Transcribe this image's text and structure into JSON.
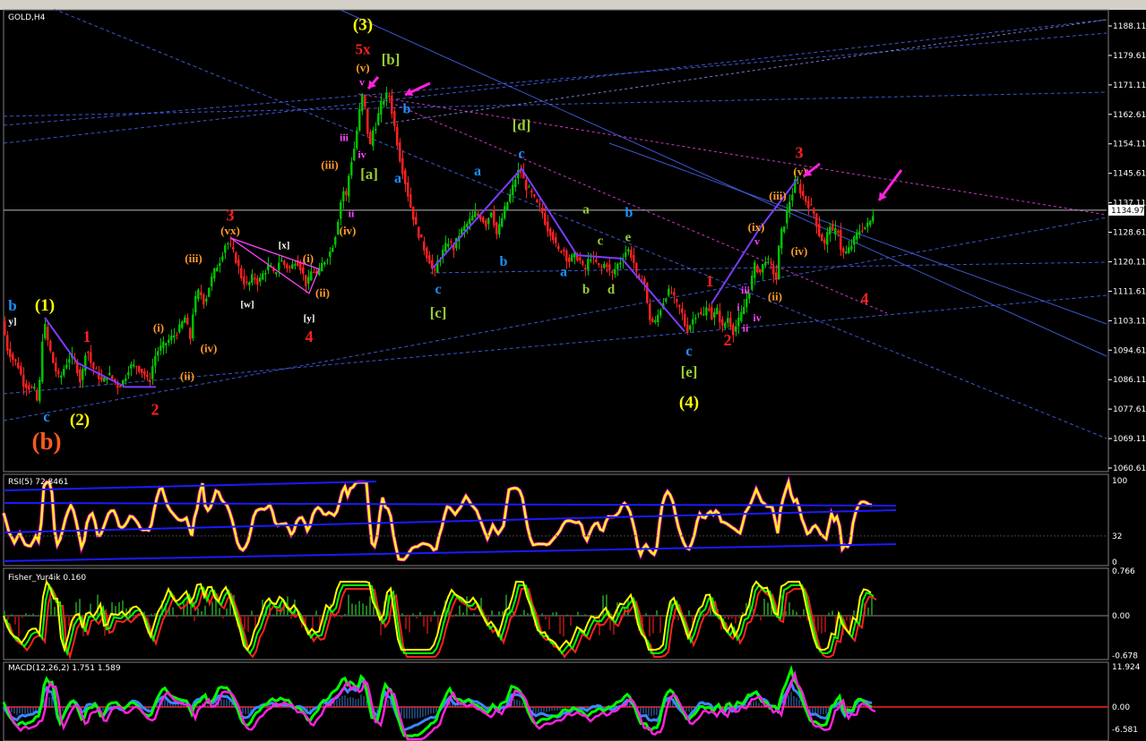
{
  "chart_data": [
    {
      "type": "candlestick",
      "title": "GOLD,H4",
      "ylim": [
        1058,
        1192
      ],
      "y_ticks": [
        "1188.11",
        "1179.61",
        "1171.11",
        "1162.61",
        "1154.11",
        "1145.61",
        "1137.11",
        "1128.61",
        "1120.11",
        "1111.61",
        "1103.11",
        "1094.61",
        "1086.11",
        "1077.61",
        "1069.11",
        "1060.61"
      ],
      "y_tick_values": [
        1188.11,
        1179.61,
        1171.11,
        1162.61,
        1154.11,
        1145.61,
        1137.11,
        1128.61,
        1120.11,
        1111.61,
        1103.11,
        1094.61,
        1086.11,
        1077.61,
        1069.11,
        1060.61
      ],
      "current_price": "1134.97",
      "current_price_value": 1134.97,
      "price_path": [
        [
          0,
          1103
        ],
        [
          6,
          1095
        ],
        [
          12,
          1092
        ],
        [
          18,
          1090
        ],
        [
          24,
          1085
        ],
        [
          30,
          1084
        ],
        [
          36,
          1083
        ],
        [
          40,
          1079
        ],
        [
          44,
          1092
        ],
        [
          46,
          1104
        ],
        [
          52,
          1096
        ],
        [
          58,
          1090
        ],
        [
          64,
          1086
        ],
        [
          70,
          1090
        ],
        [
          76,
          1093
        ],
        [
          82,
          1091
        ],
        [
          88,
          1085
        ],
        [
          94,
          1096
        ],
        [
          100,
          1090
        ],
        [
          106,
          1088
        ],
        [
          112,
          1085
        ],
        [
          118,
          1088
        ],
        [
          124,
          1086
        ],
        [
          130,
          1084
        ],
        [
          136,
          1086
        ],
        [
          142,
          1090
        ],
        [
          150,
          1090
        ],
        [
          158,
          1088
        ],
        [
          164,
          1085
        ],
        [
          168,
          1090
        ],
        [
          172,
          1094
        ],
        [
          180,
          1096
        ],
        [
          188,
          1098
        ],
        [
          196,
          1100
        ],
        [
          204,
          1104
        ],
        [
          210,
          1098
        ],
        [
          214,
          1108
        ],
        [
          220,
          1112
        ],
        [
          226,
          1108
        ],
        [
          232,
          1114
        ],
        [
          238,
          1118
        ],
        [
          244,
          1121
        ],
        [
          250,
          1126
        ],
        [
          256,
          1124
        ],
        [
          262,
          1120
        ],
        [
          268,
          1115
        ],
        [
          274,
          1113
        ],
        [
          280,
          1116
        ],
        [
          286,
          1114
        ],
        [
          292,
          1117
        ],
        [
          298,
          1119
        ],
        [
          304,
          1116
        ],
        [
          310,
          1121
        ],
        [
          316,
          1119
        ],
        [
          322,
          1118
        ],
        [
          328,
          1121
        ],
        [
          334,
          1118
        ],
        [
          340,
          1113
        ],
        [
          346,
          1118
        ],
        [
          352,
          1116
        ],
        [
          358,
          1120
        ],
        [
          362,
          1121
        ],
        [
          368,
          1124
        ],
        [
          372,
          1128
        ],
        [
          376,
          1134
        ],
        [
          380,
          1141
        ],
        [
          384,
          1139
        ],
        [
          388,
          1147
        ],
        [
          394,
          1154
        ],
        [
          398,
          1162
        ],
        [
          402,
          1168
        ],
        [
          406,
          1163
        ],
        [
          410,
          1152
        ],
        [
          414,
          1158
        ],
        [
          418,
          1160
        ],
        [
          422,
          1165
        ],
        [
          428,
          1168
        ],
        [
          432,
          1168
        ],
        [
          436,
          1162
        ],
        [
          440,
          1156
        ],
        [
          444,
          1150
        ],
        [
          450,
          1143
        ],
        [
          456,
          1136
        ],
        [
          462,
          1130
        ],
        [
          468,
          1126
        ],
        [
          474,
          1122
        ],
        [
          478,
          1120
        ],
        [
          482,
          1116
        ],
        [
          486,
          1120
        ],
        [
          492,
          1123
        ],
        [
          498,
          1126
        ],
        [
          504,
          1124
        ],
        [
          510,
          1128
        ],
        [
          516,
          1130
        ],
        [
          522,
          1132
        ],
        [
          528,
          1134
        ],
        [
          534,
          1133
        ],
        [
          540,
          1131
        ],
        [
          546,
          1135
        ],
        [
          552,
          1128
        ],
        [
          556,
          1131
        ],
        [
          562,
          1136
        ],
        [
          568,
          1140
        ],
        [
          574,
          1145
        ],
        [
          578,
          1147
        ],
        [
          584,
          1142
        ],
        [
          590,
          1140
        ],
        [
          596,
          1137
        ],
        [
          602,
          1135
        ],
        [
          608,
          1130
        ],
        [
          614,
          1128
        ],
        [
          620,
          1123
        ],
        [
          626,
          1124
        ],
        [
          632,
          1120
        ],
        [
          638,
          1122
        ],
        [
          644,
          1121
        ],
        [
          650,
          1117
        ],
        [
          656,
          1122
        ],
        [
          662,
          1120
        ],
        [
          668,
          1118
        ],
        [
          674,
          1120
        ],
        [
          680,
          1116
        ],
        [
          686,
          1119
        ],
        [
          692,
          1121
        ],
        [
          698,
          1124
        ],
        [
          704,
          1121
        ],
        [
          710,
          1114
        ],
        [
          716,
          1116
        ],
        [
          722,
          1104
        ],
        [
          728,
          1102
        ],
        [
          734,
          1106
        ],
        [
          740,
          1110
        ],
        [
          746,
          1112
        ],
        [
          752,
          1108
        ],
        [
          758,
          1106
        ],
        [
          764,
          1100
        ],
        [
          770,
          1103
        ],
        [
          776,
          1106
        ],
        [
          782,
          1104
        ],
        [
          788,
          1108
        ],
        [
          792,
          1104
        ],
        [
          798,
          1106
        ],
        [
          804,
          1101
        ],
        [
          810,
          1104
        ],
        [
          816,
          1100
        ],
        [
          822,
          1103
        ],
        [
          828,
          1107
        ],
        [
          834,
          1112
        ],
        [
          840,
          1119
        ],
        [
          846,
          1117
        ],
        [
          852,
          1121
        ],
        [
          858,
          1119
        ],
        [
          864,
          1115
        ],
        [
          868,
          1127
        ],
        [
          874,
          1132
        ],
        [
          878,
          1137
        ],
        [
          882,
          1140
        ],
        [
          886,
          1144
        ],
        [
          890,
          1141
        ],
        [
          896,
          1138
        ],
        [
          902,
          1136
        ],
        [
          906,
          1134
        ],
        [
          912,
          1128
        ],
        [
          918,
          1125
        ],
        [
          924,
          1131
        ],
        [
          928,
          1127
        ],
        [
          932,
          1131
        ],
        [
          936,
          1124
        ],
        [
          940,
          1122
        ],
        [
          946,
          1124
        ],
        [
          950,
          1126
        ],
        [
          956,
          1129
        ],
        [
          962,
          1130
        ],
        [
          968,
          1131
        ],
        [
          972,
          1134
        ]
      ],
      "wave_labels": [
        {
          "text": "(3)",
          "price": 1187,
          "bar": 401,
          "color": "#ffff00",
          "size": 19
        },
        {
          "text": "5x",
          "price": 1180,
          "bar": 401,
          "color": "#ff2020",
          "size": 17
        },
        {
          "text": "(v)",
          "price": 1175,
          "bar": 401,
          "color": "#ff9a28",
          "size": 13
        },
        {
          "text": "v",
          "price": 1171,
          "bar": 400,
          "color": "#ff44ff",
          "size": 12
        },
        {
          "text": "[b]",
          "price": 1177,
          "bar": 432,
          "color": "#9acd32",
          "size": 17
        },
        {
          "text": "b",
          "price": 1163,
          "bar": 450,
          "color": "#1e90ff",
          "size": 16
        },
        {
          "text": "iii",
          "price": 1155,
          "bar": 380,
          "color": "#ff44ff",
          "size": 12
        },
        {
          "text": "iv",
          "price": 1150,
          "bar": 400,
          "color": "#ff44ff",
          "size": 12
        },
        {
          "text": "(iii)",
          "price": 1147,
          "bar": 364,
          "color": "#ff9a28",
          "size": 13
        },
        {
          "text": "[a]",
          "price": 1144,
          "bar": 408,
          "color": "#9acd32",
          "size": 17
        },
        {
          "text": "a",
          "price": 1143,
          "bar": 440,
          "color": "#1e90ff",
          "size": 16
        },
        {
          "text": "ii",
          "price": 1133,
          "bar": 388,
          "color": "#ff44ff",
          "size": 12
        },
        {
          "text": "(iv)",
          "price": 1128,
          "bar": 384,
          "color": "#ff9a28",
          "size": 13
        },
        {
          "text": "3",
          "price": 1132,
          "bar": 253,
          "color": "#ff2020",
          "size": 18
        },
        {
          "text": "(vx)",
          "price": 1128,
          "bar": 253,
          "color": "#ff9a28",
          "size": 13
        },
        {
          "text": "[x]",
          "price": 1124,
          "bar": 313,
          "color": "#ffffff",
          "size": 11
        },
        {
          "text": "(iii)",
          "price": 1120,
          "bar": 212,
          "color": "#ff9a28",
          "size": 13
        },
        {
          "text": "(i)",
          "price": 1120,
          "bar": 340,
          "color": "#ff9a28",
          "size": 13
        },
        {
          "text": "(ii)",
          "price": 1110,
          "bar": 356,
          "color": "#ff9a28",
          "size": 13
        },
        {
          "text": "[w]",
          "price": 1107,
          "bar": 272,
          "color": "#ffffff",
          "size": 11
        },
        {
          "text": "[y]",
          "price": 1103,
          "bar": 341,
          "color": "#ffffff",
          "size": 11
        },
        {
          "text": "4",
          "price": 1097,
          "bar": 341,
          "color": "#ff2020",
          "size": 18
        },
        {
          "text": "b",
          "price": 1106,
          "bar": 10,
          "color": "#1e90ff",
          "size": 17
        },
        {
          "text": "(1)",
          "price": 1106,
          "bar": 46,
          "color": "#ffff00",
          "size": 19
        },
        {
          "text": "y]",
          "price": 1102,
          "bar": 10,
          "color": "#ffffff",
          "size": 11
        },
        {
          "text": "1",
          "price": 1097,
          "bar": 93,
          "color": "#ff2020",
          "size": 18
        },
        {
          "text": "(i)",
          "price": 1100,
          "bar": 173,
          "color": "#ff9a28",
          "size": 13
        },
        {
          "text": "(iv)",
          "price": 1094,
          "bar": 229,
          "color": "#ff9a28",
          "size": 13
        },
        {
          "text": "(ii)",
          "price": 1086,
          "bar": 205,
          "color": "#ff9a28",
          "size": 13
        },
        {
          "text": "2",
          "price": 1076,
          "bar": 169,
          "color": "#ff2020",
          "size": 18
        },
        {
          "text": "c",
          "price": 1074,
          "bar": 48,
          "color": "#1e90ff",
          "size": 17
        },
        {
          "text": "(2)",
          "price": 1073,
          "bar": 85,
          "color": "#ffff00",
          "size": 19
        },
        {
          "text": "(b)",
          "price": 1066,
          "bar": 48,
          "color": "#ff5a1e",
          "size": 27
        },
        {
          "text": "[d]",
          "price": 1158,
          "bar": 578,
          "color": "#9acd32",
          "size": 17
        },
        {
          "text": "c",
          "price": 1150,
          "bar": 578,
          "color": "#1e90ff",
          "size": 16
        },
        {
          "text": "a",
          "price": 1145,
          "bar": 529,
          "color": "#1e90ff",
          "size": 16
        },
        {
          "text": "a",
          "price": 1134,
          "bar": 650,
          "color": "#9acd32",
          "size": 15
        },
        {
          "text": "b",
          "price": 1133,
          "bar": 698,
          "color": "#1e90ff",
          "size": 16
        },
        {
          "text": "e",
          "price": 1126,
          "bar": 697,
          "color": "#9acd32",
          "size": 15
        },
        {
          "text": "c",
          "price": 1125,
          "bar": 666,
          "color": "#9acd32",
          "size": 15
        },
        {
          "text": "b",
          "price": 1119,
          "bar": 558,
          "color": "#1e90ff",
          "size": 16
        },
        {
          "text": "a",
          "price": 1116,
          "bar": 625,
          "color": "#1e90ff",
          "size": 16
        },
        {
          "text": "b",
          "price": 1111,
          "bar": 650,
          "color": "#9acd32",
          "size": 15
        },
        {
          "text": "d",
          "price": 1111,
          "bar": 678,
          "color": "#9acd32",
          "size": 15
        },
        {
          "text": "c",
          "price": 1111,
          "bar": 485,
          "color": "#1e90ff",
          "size": 16
        },
        {
          "text": "[c]",
          "price": 1104,
          "bar": 485,
          "color": "#9acd32",
          "size": 17
        },
        {
          "text": "3",
          "price": 1150,
          "bar": 888,
          "color": "#ff2020",
          "size": 18
        },
        {
          "text": "(v)",
          "price": 1145,
          "bar": 889,
          "color": "#ff9a28",
          "size": 13
        },
        {
          "text": "(iii)",
          "price": 1138,
          "bar": 864,
          "color": "#ff9a28",
          "size": 13
        },
        {
          "text": "(ix)",
          "price": 1129,
          "bar": 840,
          "color": "#ff9a28",
          "size": 13
        },
        {
          "text": "v",
          "price": 1125,
          "bar": 841,
          "color": "#ff44ff",
          "size": 12
        },
        {
          "text": "(iv)",
          "price": 1122,
          "bar": 888,
          "color": "#ff9a28",
          "size": 13
        },
        {
          "text": "1",
          "price": 1113,
          "bar": 788,
          "color": "#ff2020",
          "size": 18
        },
        {
          "text": "iii",
          "price": 1111,
          "bar": 828,
          "color": "#ff44ff",
          "size": 12
        },
        {
          "text": "(ii)",
          "price": 1109,
          "bar": 861,
          "color": "#ff9a28",
          "size": 13
        },
        {
          "text": "i",
          "price": 1106,
          "bar": 820,
          "color": "#ff44ff",
          "size": 12
        },
        {
          "text": "iv",
          "price": 1103,
          "bar": 841,
          "color": "#ff44ff",
          "size": 12
        },
        {
          "text": "4",
          "price": 1108,
          "bar": 961,
          "color": "#ff2020",
          "size": 18
        },
        {
          "text": "ii",
          "price": 1100,
          "bar": 828,
          "color": "#ff44ff",
          "size": 12
        },
        {
          "text": "2",
          "price": 1096,
          "bar": 808,
          "color": "#ff2020",
          "size": 18
        },
        {
          "text": "c",
          "price": 1093,
          "bar": 765,
          "color": "#1e90ff",
          "size": 17
        },
        {
          "text": "[e]",
          "price": 1087,
          "bar": 765,
          "color": "#9acd32",
          "size": 17
        },
        {
          "text": "(4)",
          "price": 1078,
          "bar": 765,
          "color": "#ffff00",
          "size": 19
        }
      ]
    },
    {
      "type": "line",
      "title": "RSI(5) 72.8461",
      "ylim": [
        0,
        100
      ],
      "y_ticks": [
        "100",
        "32",
        "0"
      ],
      "y_tick_values": [
        100,
        32,
        0
      ]
    },
    {
      "type": "line",
      "title": "Fisher_Yur4ik 0.160",
      "y_ticks": [
        "0.766",
        "0.00",
        "-0.678"
      ],
      "y_tick_values": [
        0.766,
        0,
        -0.678
      ]
    },
    {
      "type": "line",
      "title": "MACD(12,26,2) 1.751 1.589",
      "y_ticks": [
        "11.924",
        "0.00",
        "-6.581"
      ],
      "y_tick_values": [
        11.924,
        0,
        -6.581
      ]
    }
  ],
  "colors": {
    "bull": "#00c000",
    "bear": "#ff2020",
    "rsi": "#ffff00",
    "arrow": "#ff22dd",
    "channel": "#ff44ff",
    "trend": "#4a6cff"
  }
}
